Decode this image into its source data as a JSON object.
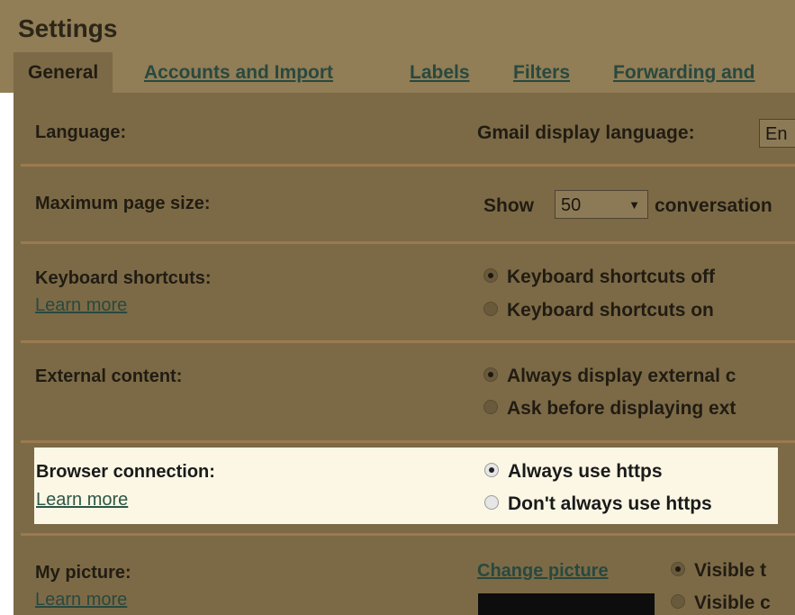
{
  "title": "Settings",
  "tabs": [
    {
      "label": "General"
    },
    {
      "label": "Accounts and Import"
    },
    {
      "label": "Labels"
    },
    {
      "label": "Filters"
    },
    {
      "label": "Forwarding and"
    }
  ],
  "language": {
    "label": "Language:",
    "setting": "Gmail display language:",
    "value": "En"
  },
  "page_size": {
    "label": "Maximum page size:",
    "show": "Show",
    "value": "50",
    "suffix": "conversation"
  },
  "keyboard": {
    "label": "Keyboard shortcuts:",
    "learn_more": "Learn more",
    "options": [
      "Keyboard shortcuts off",
      "Keyboard shortcuts on"
    ],
    "selected": 0
  },
  "external": {
    "label": "External content:",
    "options": [
      "Always display external c",
      "Ask before displaying ext"
    ],
    "selected": 0
  },
  "browser": {
    "label": "Browser connection:",
    "learn_more": "Learn more",
    "options": [
      "Always use https",
      "Don't always use https"
    ],
    "selected": 0
  },
  "picture": {
    "label": "My picture:",
    "learn_more": "Learn more",
    "change_link": "Change picture",
    "options": [
      "Visible t",
      "Visible c"
    ],
    "selected": 0
  },
  "icons": {
    "select_arrow": "▼"
  },
  "colors": {
    "header": "#917d56",
    "panel": "#7c6a47",
    "highlight": "#fbf7e4",
    "link": "#28493f"
  }
}
